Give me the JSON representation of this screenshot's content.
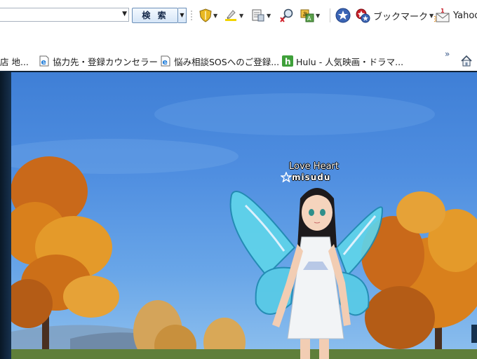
{
  "toolbar": {
    "search_input_value": "",
    "search_button_label": "検 索",
    "bookmark_label": "ブックマーク",
    "yahoo_label": "Yahoo"
  },
  "links_bar": {
    "items": [
      {
        "label": "店 地...",
        "icon": "none"
      },
      {
        "label": "協力先・登録カウンセラー",
        "icon": "ie-page-icon"
      },
      {
        "label": "悩み相談SOSへのご登録...",
        "icon": "ie-page-icon"
      },
      {
        "label": "Hulu - 人気映画・ドラマ...",
        "icon": "hulu-icon"
      }
    ],
    "more_glyph": "»"
  },
  "game": {
    "player_title": "Love Heart",
    "player_name": "misudu"
  },
  "colors": {
    "sky": "#4f8ee0",
    "foliage": "#d9801c",
    "search_button": "#d6e6f7"
  }
}
